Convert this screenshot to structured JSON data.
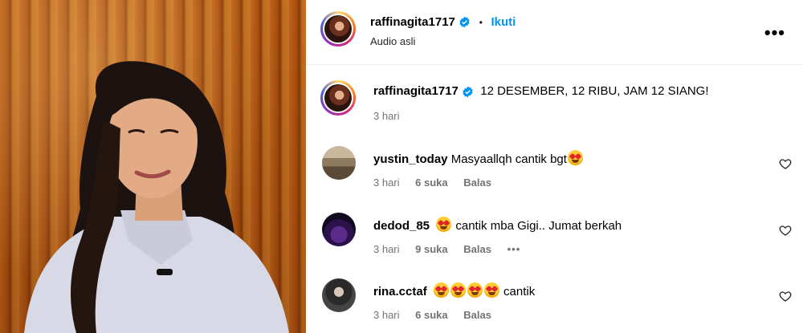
{
  "header": {
    "username": "raffinagita1717",
    "separator": "•",
    "follow_label": "Ikuti",
    "audio_label": "Audio asli",
    "more_icon": "more-options-icon"
  },
  "caption": {
    "username": "raffinagita1717",
    "text": "12 DESEMBER, 12 RIBU, JAM 12 SIANG!",
    "time": "3 hari"
  },
  "comments": [
    {
      "username": "yustin_today",
      "text_before": "Masyaallqh cantik bgt",
      "emoji_count": 1,
      "text_after": "",
      "time": "3 hari",
      "likes": "6 suka",
      "reply": "Balas",
      "more": ""
    },
    {
      "username": "dedod_85",
      "text_before": "",
      "emoji_count": 1,
      "text_after": "cantik mba Gigi.. Jumat berkah",
      "time": "3 hari",
      "likes": "9 suka",
      "reply": "Balas",
      "more": "•••"
    },
    {
      "username": "rina.cctaf",
      "text_before": "",
      "emoji_count": 4,
      "text_after": "cantik",
      "time": "3 hari",
      "likes": "6 suka",
      "reply": "Balas",
      "more": ""
    }
  ],
  "colors": {
    "accent": "#0095f6",
    "verified": "#0095f6",
    "muted": "#737373"
  }
}
